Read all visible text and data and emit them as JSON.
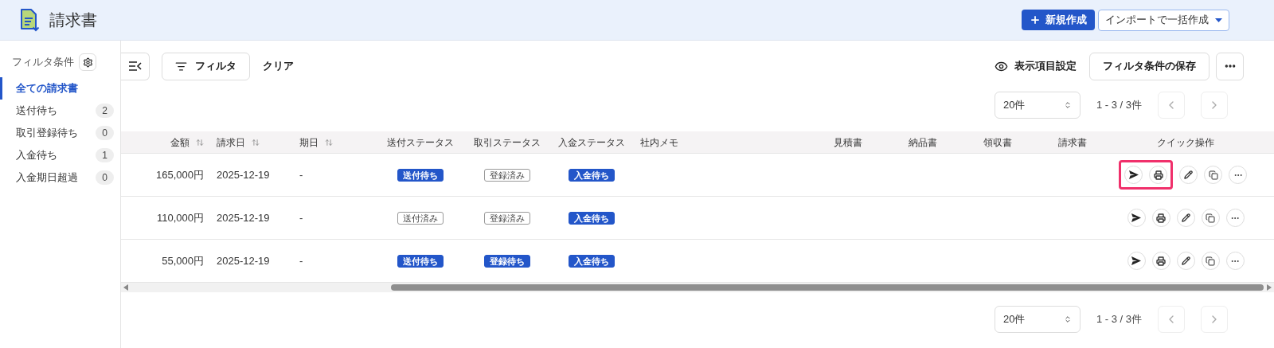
{
  "header": {
    "title": "請求書",
    "new_button": "新規作成",
    "import_button": "インポートで一括作成"
  },
  "sidebar": {
    "title": "フィルタ条件",
    "items": [
      {
        "label": "全ての請求書",
        "selected": true
      },
      {
        "label": "送付待ち",
        "count": "2",
        "selected": false
      },
      {
        "label": "取引登録待ち",
        "count": "0",
        "selected": false
      },
      {
        "label": "入金待ち",
        "count": "1",
        "selected": false
      },
      {
        "label": "入金期日超過",
        "count": "0",
        "selected": false
      }
    ]
  },
  "toolbar": {
    "filter": "フィルタ",
    "clear": "クリア",
    "columns": "表示項目設定",
    "save_filter": "フィルタ条件の保存"
  },
  "pagination_top": {
    "page_size": "20件",
    "range": "1 - 3 / 3件"
  },
  "table": {
    "columns": [
      {
        "label": "金額",
        "sortable": true
      },
      {
        "label": "請求日",
        "sortable": true
      },
      {
        "label": "期日",
        "sortable": true
      },
      {
        "label": "送付ステータス",
        "sortable": false
      },
      {
        "label": "取引ステータス",
        "sortable": false
      },
      {
        "label": "入金ステータス",
        "sortable": false
      },
      {
        "label": "社内メモ",
        "sortable": false
      },
      {
        "label": "見積書",
        "sortable": false
      },
      {
        "label": "納品書",
        "sortable": false
      },
      {
        "label": "領収書",
        "sortable": false
      },
      {
        "label": "請求書",
        "sortable": false
      },
      {
        "label": "クイック操作",
        "sortable": false
      }
    ],
    "rows": [
      {
        "amount": "165,000円",
        "date": "2025-12-19",
        "due": "-",
        "send": {
          "label": "送付待ち",
          "kind": "filled"
        },
        "deal": {
          "label": "登録済み",
          "kind": "outline"
        },
        "payment": {
          "label": "入金待ち",
          "kind": "filled"
        },
        "highlighted": true
      },
      {
        "amount": "110,000円",
        "date": "2025-12-19",
        "due": "-",
        "send": {
          "label": "送付済み",
          "kind": "outline"
        },
        "deal": {
          "label": "登録済み",
          "kind": "outline"
        },
        "payment": {
          "label": "入金待ち",
          "kind": "filled"
        },
        "highlighted": false
      },
      {
        "amount": "55,000円",
        "date": "2025-12-19",
        "due": "-",
        "send": {
          "label": "送付待ち",
          "kind": "filled"
        },
        "deal": {
          "label": "登録待ち",
          "kind": "filled"
        },
        "payment": {
          "label": "入金待ち",
          "kind": "filled"
        },
        "highlighted": false
      }
    ]
  },
  "pagination_bottom": {
    "page_size": "20件",
    "range": "1 - 3 / 3件"
  }
}
